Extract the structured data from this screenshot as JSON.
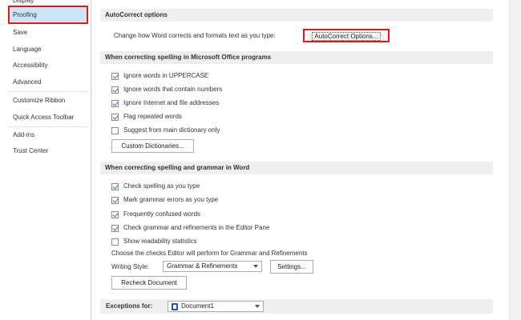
{
  "sidebar": {
    "items": [
      {
        "label": "Display"
      },
      {
        "label": "Proofing"
      },
      {
        "label": "Save"
      },
      {
        "label": "Language"
      },
      {
        "label": "Accessibility"
      },
      {
        "label": "Advanced"
      },
      {
        "label": "Customize Ribbon"
      },
      {
        "label": "Quick Access Toolbar"
      },
      {
        "label": "Add-ins"
      },
      {
        "label": "Trust Center"
      }
    ],
    "selected": "Proofing"
  },
  "autocorrect": {
    "heading": "AutoCorrect options",
    "description": "Change how Word corrects and formats text as you type:",
    "button_label": "AutoCorrect Options..."
  },
  "office_spelling": {
    "heading": "When correcting spelling in Microsoft Office programs",
    "options": [
      {
        "label": "Ignore words in UPPERCASE",
        "checked": true
      },
      {
        "label": "Ignore words that contain numbers",
        "checked": true
      },
      {
        "label": "Ignore Internet and file addresses",
        "checked": true
      },
      {
        "label": "Flag repeated words",
        "checked": true
      },
      {
        "label": "Suggest from main dictionary only",
        "checked": false
      }
    ],
    "custom_dictionaries_label": "Custom Dictionaries..."
  },
  "word_spelling": {
    "heading": "When correcting spelling and grammar in Word",
    "options": [
      {
        "label": "Check spelling as you type",
        "checked": true
      },
      {
        "label": "Mark grammar errors as you type",
        "checked": true
      },
      {
        "label": "Frequently confused words",
        "checked": true
      },
      {
        "label": "Check grammar and refinements in the Editor Pane",
        "checked": true
      },
      {
        "label": "Show readability statistics",
        "checked": false
      }
    ],
    "editor_checks_text": "Choose the checks Editor will perform for Grammar and Refinements",
    "writing_style_label": "Writing Style:",
    "writing_style_value": "Grammar & Refinements",
    "settings_label": "Settings...",
    "recheck_label": "Recheck Document"
  },
  "exceptions": {
    "label": "Exceptions for:",
    "document": "Document1"
  },
  "colors": {
    "highlight_red": "#e01a1a",
    "selected_bg": "#cce4f7",
    "section_bg": "#efefef",
    "check_blue": "#3a6fb0"
  }
}
